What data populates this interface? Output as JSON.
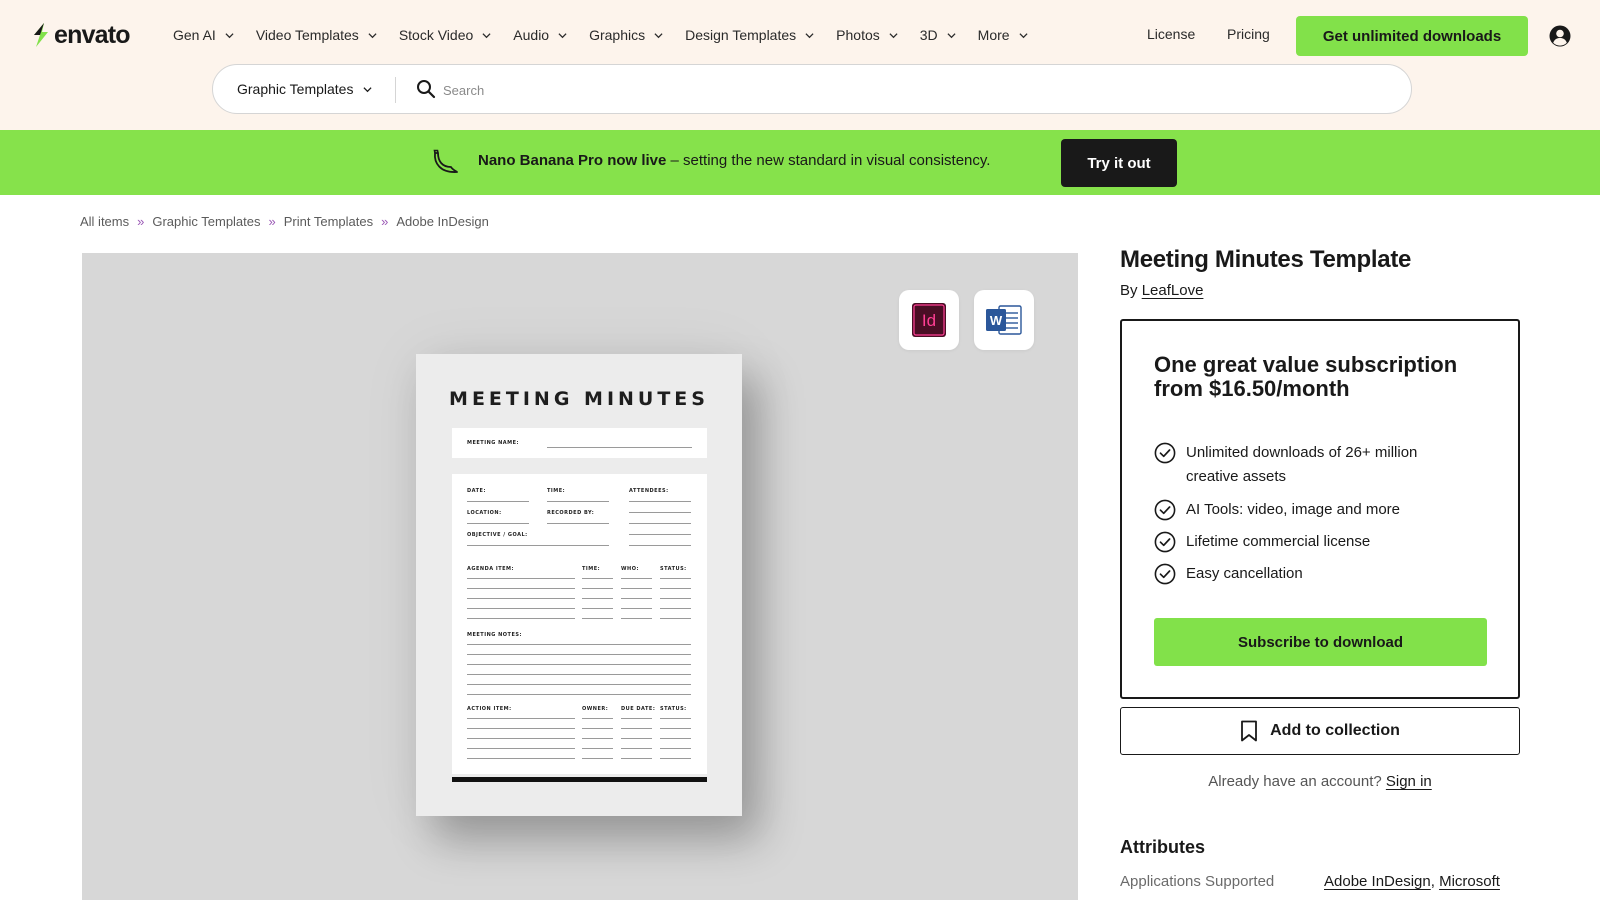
{
  "brand": {
    "name": "envato",
    "accent": "#82e14a",
    "header_bg": "#fdf4ec",
    "banner_bg": "#86e24b"
  },
  "nav": {
    "items": [
      {
        "label": "Gen AI"
      },
      {
        "label": "Video Templates"
      },
      {
        "label": "Stock Video"
      },
      {
        "label": "Audio"
      },
      {
        "label": "Graphics"
      },
      {
        "label": "Design Templates"
      },
      {
        "label": "Photos"
      },
      {
        "label": "3D"
      },
      {
        "label": "More"
      }
    ],
    "license": "License",
    "pricing": "Pricing",
    "cta": "Get unlimited downloads",
    "user_icon": "user-circle-icon"
  },
  "search": {
    "category": "Graphic Templates",
    "placeholder": "Search",
    "value": ""
  },
  "banner": {
    "bold": "Nano Banana Pro now live",
    "text": " – setting the new standard in visual consistency.",
    "button": "Try it out",
    "icon": "banana-icon"
  },
  "breadcrumb": {
    "items": [
      "All items",
      "Graphic Templates",
      "Print Templates",
      "Adobe InDesign"
    ],
    "separator": "»"
  },
  "preview": {
    "badges": [
      {
        "icon": "adobe-indesign-icon",
        "text": "Id"
      },
      {
        "icon": "microsoft-word-icon",
        "text": "W"
      }
    ],
    "document": {
      "title": "MEETING MINUTES",
      "labels": {
        "meeting_name": "MEETING NAME:",
        "date": "DATE:",
        "time": "TIME:",
        "attendees": "ATTENDEES:",
        "location": "LOCATION:",
        "recorded_by": "RECORDED BY:",
        "objective": "OBJECTIVE / GOAL:",
        "agenda_item": "AGENDA ITEM:",
        "agenda_time": "TIME:",
        "who": "WHO:",
        "status": "STATUS:",
        "notes": "MEETING NOTES:",
        "action_item": "ACTION ITEM:",
        "owner": "OWNER:",
        "due_date": "DUE DATE:",
        "action_status": "STATUS:"
      }
    }
  },
  "product": {
    "title": "Meeting Minutes Template",
    "by": "By",
    "author": "LeafLove"
  },
  "subscription": {
    "heading": "One great value subscription from $16.50/month",
    "features": [
      "Unlimited downloads of 26+ million creative assets",
      "AI Tools: video, image and more",
      "Lifetime commercial license",
      "Easy cancellation"
    ],
    "button": "Subscribe to download"
  },
  "collection": {
    "button": "Add to collection"
  },
  "account": {
    "prompt": "Already have an account?",
    "link": "Sign in"
  },
  "attributes": {
    "heading": "Attributes",
    "rows": [
      {
        "label": "Applications Supported",
        "values": [
          "Adobe InDesign",
          "Microsoft"
        ]
      }
    ]
  }
}
